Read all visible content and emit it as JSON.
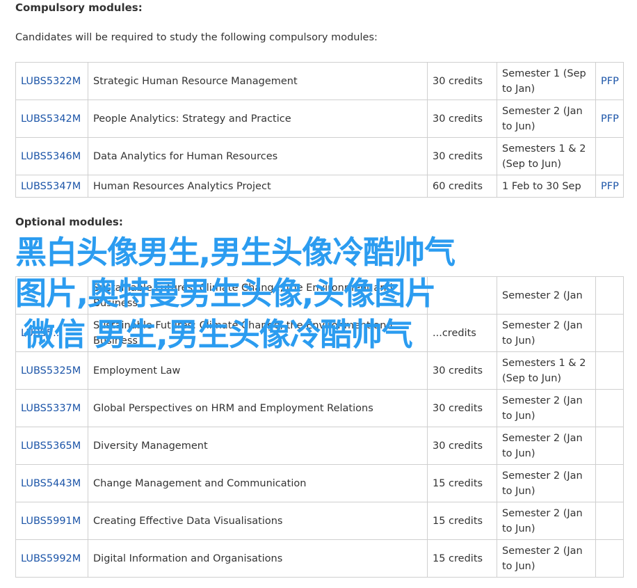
{
  "compulsory": {
    "heading": "Compulsory modules:",
    "intro": "Candidates will be required to study the following compulsory modules:",
    "rows": [
      {
        "code": "LUBS5322M",
        "title": "Strategic Human Resource Management",
        "credits": "30 credits",
        "semester": "Semester 1 (Sep to Jan)",
        "pfp": "PFP"
      },
      {
        "code": "LUBS5342M",
        "title": "People Analytics: Strategy and Practice",
        "credits": "30 credits",
        "semester": "Semester 2 (Jan to Jun)",
        "pfp": "PFP"
      },
      {
        "code": "LUBS5346M",
        "title": "Data Analytics for Human Resources",
        "credits": "30 credits",
        "semester": "Semesters 1 & 2 (Sep to Jun)",
        "pfp": ""
      },
      {
        "code": "LUBS5347M",
        "title": "Human Resources Analytics Project",
        "credits": "60 credits",
        "semester": "1 Feb to 30 Sep",
        "pfp": "PFP"
      }
    ]
  },
  "optional": {
    "heading": "Optional modules:",
    "rows": [
      {
        "code": "",
        "title": "Sustainable Futures: Climate Change, the Environment and Business",
        "credits": "",
        "semester": "Semester 2 (Jan",
        "pfp": ""
      },
      {
        "code": "LUBS5...",
        "title": "Sustainable Futures: Climate Change, the Environment and Business",
        "credits": "...credits",
        "semester": "Semester 2 (Jan to Jun)",
        "pfp": ""
      },
      {
        "code": "LUBS5325M",
        "title": "Employment Law",
        "credits": "30 credits",
        "semester": "Semesters 1 & 2 (Sep to Jun)",
        "pfp": ""
      },
      {
        "code": "LUBS5337M",
        "title": "Global Perspectives on HRM and Employment Relations",
        "credits": "30 credits",
        "semester": "Semester 2 (Jan to Jun)",
        "pfp": ""
      },
      {
        "code": "LUBS5365M",
        "title": "Diversity Management",
        "credits": "30 credits",
        "semester": "Semester 2 (Jan to Jun)",
        "pfp": ""
      },
      {
        "code": "LUBS5443M",
        "title": "Change Management and Communication",
        "credits": "15 credits",
        "semester": "Semester 2 (Jan to Jun)",
        "pfp": ""
      },
      {
        "code": "LUBS5991M",
        "title": "Creating Effective Data Visualisations",
        "credits": "15 credits",
        "semester": "Semester 2 (Jan to Jun)",
        "pfp": ""
      },
      {
        "code": "LUBS5992M",
        "title": "Digital Information and Organisations",
        "credits": "15 credits",
        "semester": "Semester 2 (Jan to Jun)",
        "pfp": ""
      }
    ]
  },
  "watermark": {
    "line1": "黑白头像男生,男生头像冷酷帅气",
    "line2": "图片,奥特曼男生头像,头像图片",
    "line3": "微信 男生,男生头像冷酷帅气",
    "color": "#2b9cf0"
  }
}
